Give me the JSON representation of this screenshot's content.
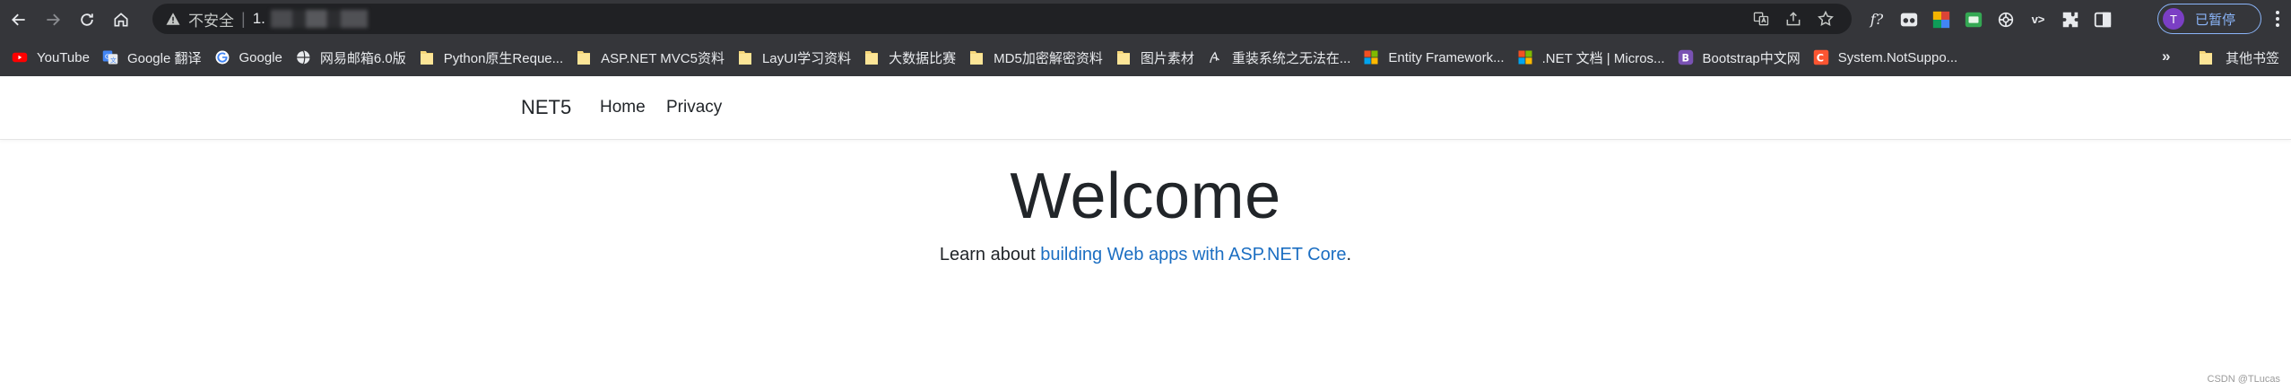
{
  "browser": {
    "address": {
      "security_label": "不安全",
      "url_text": "1.",
      "url_redacted": true
    },
    "profile": {
      "avatar_letter": "T",
      "label": "已暂停",
      "avatar_color": "#7b3fc4",
      "accent": "#8ab4f8"
    },
    "toolbar_icons": [
      "back-icon",
      "forward-icon",
      "reload-icon",
      "home-icon",
      "translate-icon",
      "share-icon",
      "star-icon",
      "function-icon",
      "glasses-icon",
      "colorgrid-icon",
      "green-ext-icon",
      "openai-icon",
      "vs-icon",
      "puzzle-icon",
      "sidepanel-icon",
      "menu-icon"
    ],
    "extension_text": {
      "function": "f?",
      "vs": "v>"
    }
  },
  "bookmarks": {
    "items": [
      {
        "label": "YouTube",
        "icon": "youtube-icon"
      },
      {
        "label": "Google 翻译",
        "icon": "google-translate-icon"
      },
      {
        "label": "Google",
        "icon": "google-icon"
      },
      {
        "label": "网易邮箱6.0版",
        "icon": "netease-icon"
      },
      {
        "label": "Python原生Reque...",
        "icon": "folder-icon"
      },
      {
        "label": "ASP.NET MVC5资料",
        "icon": "folder-icon"
      },
      {
        "label": "LayUI学习资料",
        "icon": "folder-icon"
      },
      {
        "label": "大数据比赛",
        "icon": "folder-icon"
      },
      {
        "label": "MD5加密解密资料",
        "icon": "folder-icon"
      },
      {
        "label": "图片素材",
        "icon": "folder-icon"
      },
      {
        "label": "重装系统之无法在...",
        "icon": "sogou-icon"
      },
      {
        "label": "Entity Framework...",
        "icon": "microsoft-icon"
      },
      {
        "label": ".NET 文档 | Micros...",
        "icon": "microsoft-icon"
      },
      {
        "label": "Bootstrap中文网",
        "icon": "bootstrap-icon"
      },
      {
        "label": "System.NotSuppo...",
        "icon": "csdn-icon"
      }
    ],
    "more": "»",
    "other": "其他书签"
  },
  "site": {
    "brand": "NET5",
    "nav": [
      "Home",
      "Privacy"
    ],
    "heading": "Welcome",
    "lead_text": "Learn about ",
    "lead_link": "building Web apps with ASP.NET Core",
    "lead_end": "."
  },
  "watermark": "CSDN @TLucas",
  "colors": {
    "chrome_bg": "#35363a",
    "omnibox_bg": "#202124",
    "link": "#1b6ec2",
    "text": "#212529"
  }
}
